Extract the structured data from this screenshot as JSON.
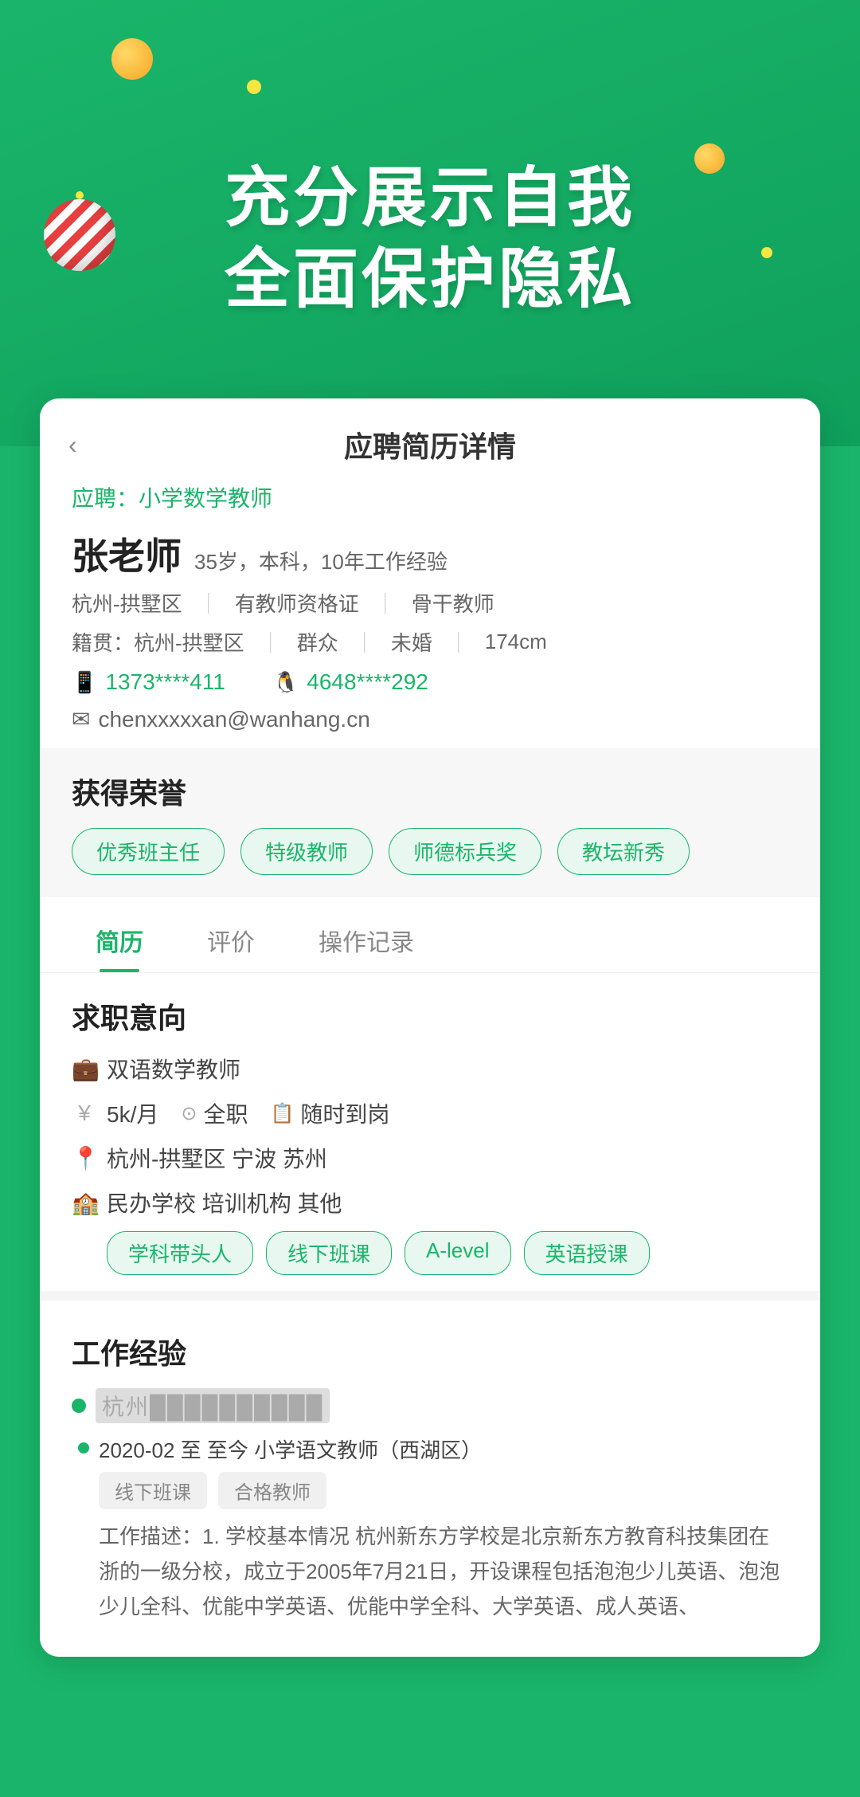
{
  "header": {
    "line1": "充分展示自我",
    "line2": "全面保护隐私"
  },
  "card": {
    "title": "应聘简历详情",
    "back_label": "‹",
    "apply_label": "应聘：小学数学教师",
    "person": {
      "name": "张老师",
      "meta": "35岁，本科，10年工作经验",
      "location": "杭州-拱墅区",
      "cert": "有教师资格证",
      "tag": "骨干教师",
      "native": "籍贯：杭州-拱墅区",
      "political": "群众",
      "marriage": "未婚",
      "height": "174cm",
      "phone": "1373****411",
      "qq": "4648****292",
      "email": "chenxxxxxan@wanhang.cn"
    },
    "honor": {
      "title": "获得荣誉",
      "tags": [
        "优秀班主任",
        "特级教师",
        "师德标兵奖",
        "教坛新秀"
      ]
    },
    "tabs": [
      {
        "id": "resume",
        "label": "简历",
        "active": true
      },
      {
        "id": "comment",
        "label": "评价",
        "active": false
      },
      {
        "id": "record",
        "label": "操作记录",
        "active": false
      }
    ],
    "intent": {
      "title": "求职意向",
      "job": "双语数学教师",
      "salary": "5k/月",
      "type": "全职",
      "available": "随时到岗",
      "locations": "杭州-拱墅区  宁波  苏州",
      "schools": "民办学校  培训机构  其他",
      "tags": [
        "学科带头人",
        "线下班课",
        "A-level",
        "英语授课"
      ]
    },
    "work": {
      "title": "工作经验",
      "company": "杭州██████████",
      "period": "2020-02 至 至今 小学语文教师（西湖区）",
      "tags": [
        "线下班课",
        "合格教师"
      ],
      "desc": "工作描述：1. 学校基本情况 杭州新东方学校是北京新东方教育科技集团在浙的一级分校，成立于2005年7月21日，开设课程包括泡泡少儿英语、泡泡少儿全科、优能中学英语、优能中学全科、大学英语、成人英语、"
    }
  }
}
